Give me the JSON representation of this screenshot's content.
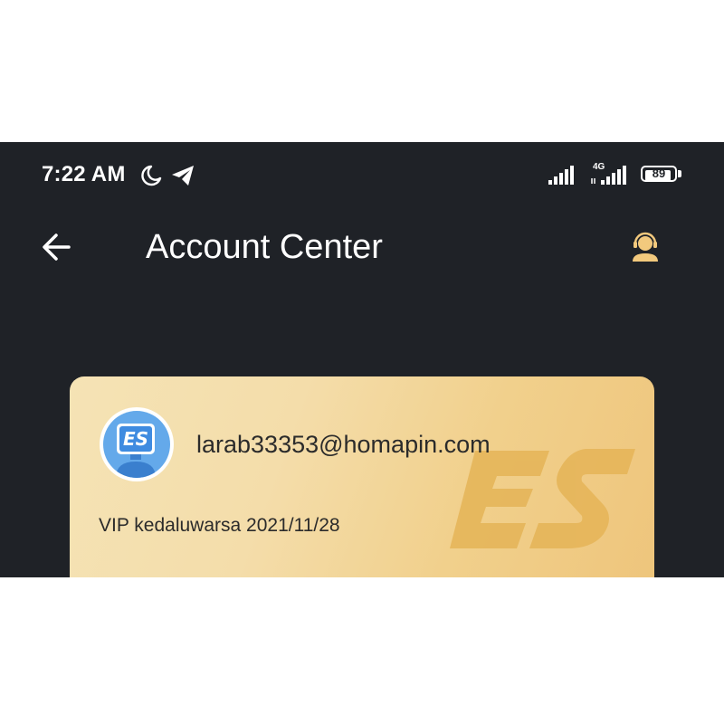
{
  "status_bar": {
    "time": "7:22 AM",
    "network_type": "4G",
    "battery_level": "89",
    "battery_fraction": 0.89,
    "icons": [
      "moon-icon",
      "telegram-icon",
      "signal-icon",
      "signal-icon",
      "battery-icon"
    ]
  },
  "toolbar": {
    "back_icon": "arrow-left-icon",
    "title": "Account Center",
    "profile_icon": "customer-service-icon"
  },
  "account_card": {
    "email": "larab33353@homapin.com",
    "vip_expiry": "VIP kedaluwarsa 2021/11/28",
    "avatar_icon": "es-logo-avatar",
    "watermark_icon": "es-logo-watermark"
  },
  "colors": {
    "background": "#1f2227",
    "accent": "#f2c97d",
    "card_gold": "#f3d9a0",
    "text_light": "#ffffff",
    "text_dark": "#2b2b2b"
  }
}
